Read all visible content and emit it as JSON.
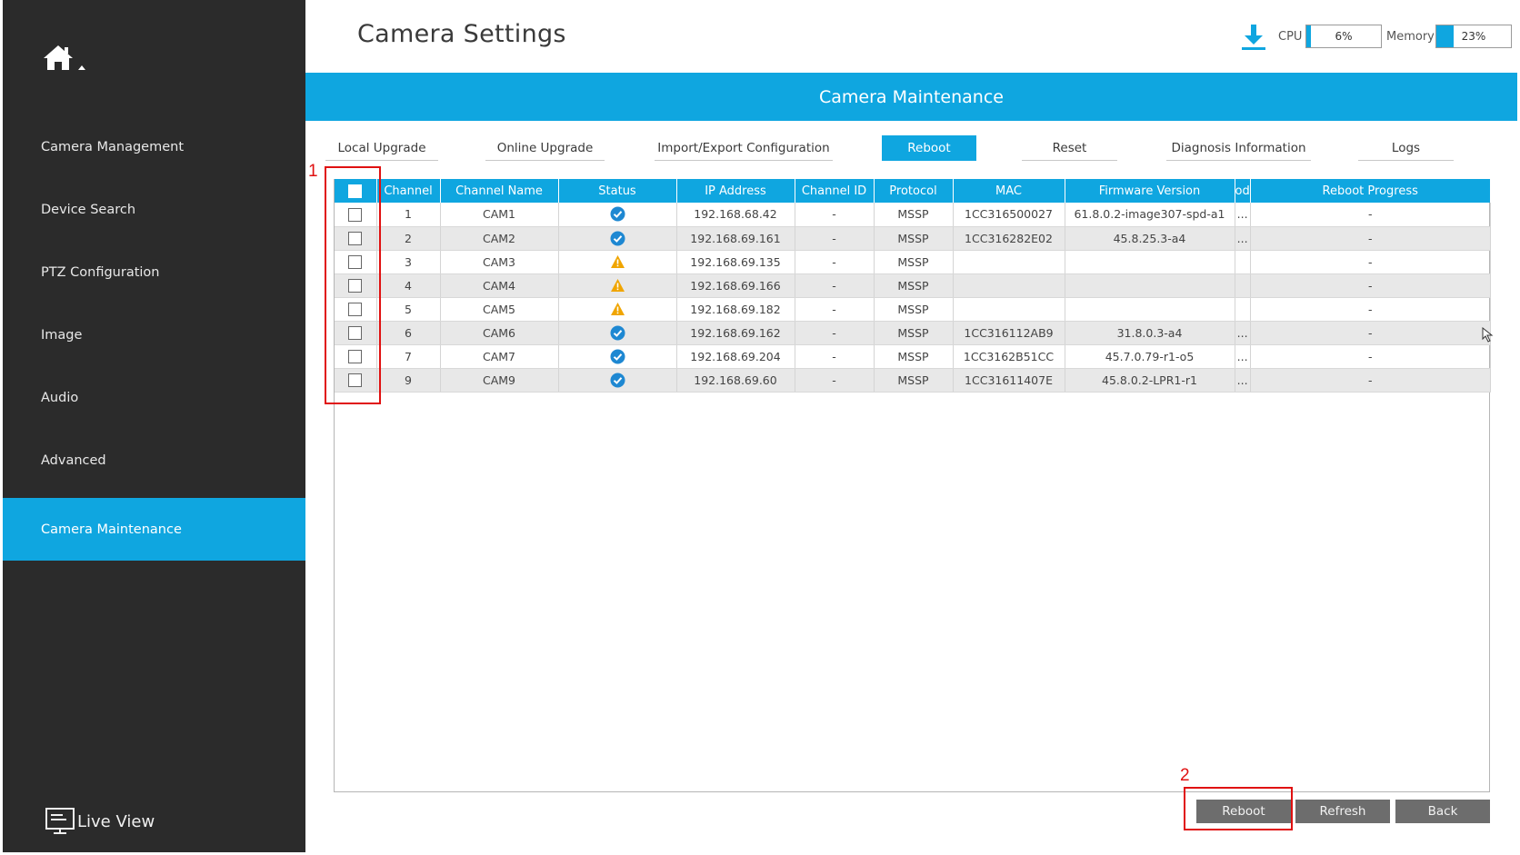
{
  "sidebar": {
    "items": [
      {
        "label": "Camera Management"
      },
      {
        "label": "Device Search"
      },
      {
        "label": "PTZ Configuration"
      },
      {
        "label": "Image"
      },
      {
        "label": "Audio"
      },
      {
        "label": "Advanced"
      },
      {
        "label": "Camera Maintenance",
        "active": true
      }
    ],
    "live_view": "Live View"
  },
  "header": {
    "title": "Camera Settings",
    "cpu_label": "CPU",
    "cpu_value": "6%",
    "cpu_level": 0.06,
    "memory_label": "Memory",
    "memory_value": "23%",
    "memory_level": 0.23
  },
  "banner": {
    "title": "Camera Maintenance"
  },
  "tabs": [
    {
      "label": "Local Upgrade"
    },
    {
      "label": "Online Upgrade"
    },
    {
      "label": "Import/Export Configuration"
    },
    {
      "label": "Reboot",
      "active": true
    },
    {
      "label": "Reset"
    },
    {
      "label": "Diagnosis Information"
    },
    {
      "label": "Logs"
    }
  ],
  "table": {
    "headers": [
      "Channel",
      "Channel Name",
      "Status",
      "IP Address",
      "Channel ID",
      "Protocol",
      "MAC",
      "Firmware Version",
      "od",
      "Reboot Progress"
    ],
    "rows": [
      {
        "channel": "1",
        "name": "CAM1",
        "status": "ok",
        "ip": "192.168.68.42",
        "cid": "-",
        "protocol": "MSSP",
        "mac": "1CC316500027",
        "fw": "61.8.0.2-image307-spd-a1",
        "od": "...",
        "progress": "-"
      },
      {
        "channel": "2",
        "name": "CAM2",
        "status": "ok",
        "ip": "192.168.69.161",
        "cid": "-",
        "protocol": "MSSP",
        "mac": "1CC316282E02",
        "fw": "45.8.25.3-a4",
        "od": "...",
        "progress": "-"
      },
      {
        "channel": "3",
        "name": "CAM3",
        "status": "warn",
        "ip": "192.168.69.135",
        "cid": "-",
        "protocol": "MSSP",
        "mac": "",
        "fw": "",
        "od": "",
        "progress": "-"
      },
      {
        "channel": "4",
        "name": "CAM4",
        "status": "warn",
        "ip": "192.168.69.166",
        "cid": "-",
        "protocol": "MSSP",
        "mac": "",
        "fw": "",
        "od": "",
        "progress": "-"
      },
      {
        "channel": "5",
        "name": "CAM5",
        "status": "warn",
        "ip": "192.168.69.182",
        "cid": "-",
        "protocol": "MSSP",
        "mac": "",
        "fw": "",
        "od": "",
        "progress": "-"
      },
      {
        "channel": "6",
        "name": "CAM6",
        "status": "ok",
        "ip": "192.168.69.162",
        "cid": "-",
        "protocol": "MSSP",
        "mac": "1CC316112AB9",
        "fw": "31.8.0.3-a4",
        "od": "...",
        "progress": "-"
      },
      {
        "channel": "7",
        "name": "CAM7",
        "status": "ok",
        "ip": "192.168.69.204",
        "cid": "-",
        "protocol": "MSSP",
        "mac": "1CC3162B51CC",
        "fw": "45.7.0.79-r1-o5",
        "od": "...",
        "progress": "-"
      },
      {
        "channel": "9",
        "name": "CAM9",
        "status": "ok",
        "ip": "192.168.69.60",
        "cid": "-",
        "protocol": "MSSP",
        "mac": "1CC31611407E",
        "fw": "45.8.0.2-LPR1-r1",
        "od": "...",
        "progress": "-"
      }
    ]
  },
  "buttons": {
    "reboot": "Reboot",
    "refresh": "Refresh",
    "back": "Back"
  },
  "annotations": {
    "one": "1",
    "two": "2"
  },
  "colors": {
    "accent": "#0fa6e0",
    "sidebar": "#2b2b2b",
    "ok": "#1e88d2",
    "warn": "#f0a500",
    "annotation": "#e01010"
  },
  "icons": {
    "home": "home-icon",
    "download": "download-icon",
    "ok": "check-circle-icon",
    "warn": "warning-icon",
    "live_view": "monitor-icon"
  }
}
